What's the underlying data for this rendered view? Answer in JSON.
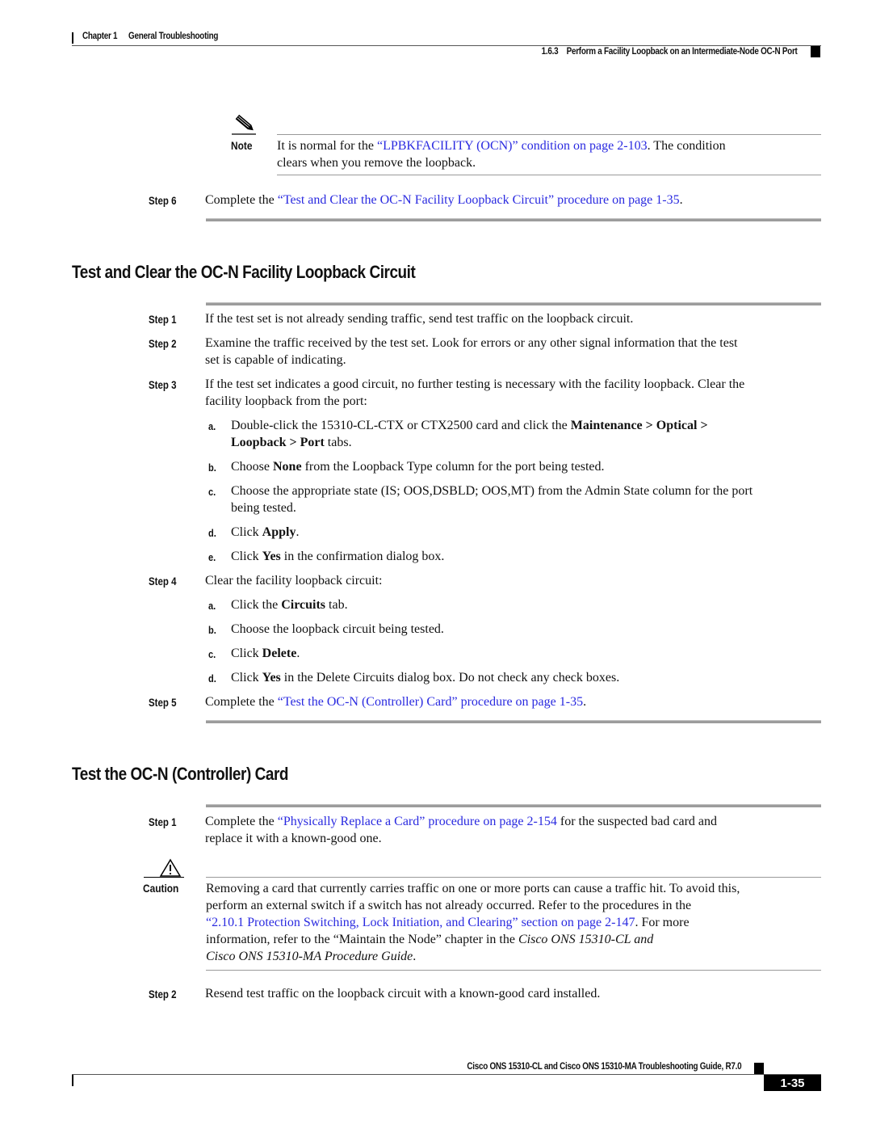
{
  "header": {
    "chapter": "Chapter 1",
    "chapter_title": "General Troubleshooting",
    "section_number": "1.6.3",
    "section_title": "Perform a Facility Loopback on an Intermediate-Node OC-N Port"
  },
  "note": {
    "icon": "pencil-note-icon",
    "label": "Note",
    "text_before": "It is normal for the ",
    "link": "“LPBKFACILITY (OCN)” condition on page 2-103",
    "text_after_line1": ". The condition",
    "line2": "clears when you remove the loopback."
  },
  "step6": {
    "label": "Step 6",
    "text_before": "Complete the ",
    "link": "“Test and Clear the OC-N Facility Loopback Circuit” procedure on page 1-35",
    "text_after": "."
  },
  "section1": {
    "title": "Test and Clear the OC-N Facility Loopback Circuit",
    "steps": [
      {
        "label": "Step 1",
        "text": "If the test set is not already sending traffic, send test traffic on the loopback circuit."
      },
      {
        "label": "Step 2",
        "line1": "Examine the traffic received by the test set. Look for errors or any other signal information that the test",
        "line2": "set is capable of indicating."
      },
      {
        "label": "Step 3",
        "line1": "If the test set indicates a good circuit, no further testing is necessary with the facility loopback. Clear the",
        "line2": "facility loopback from the port:",
        "substeps": [
          {
            "label": "a.",
            "t1": "Double-click the 15310-CL-CTX or CTX2500 card and click the ",
            "b1": "Maintenance > Optical >",
            "b2": "Loopback > Port",
            "t2": " tabs."
          },
          {
            "label": "b.",
            "t1": "Choose ",
            "b1": "None",
            "t2": " from the Loopback Type column for the port being tested."
          },
          {
            "label": "c.",
            "line1": "Choose the appropriate state (IS; OOS,DSBLD; OOS,MT) from the Admin State column for the port",
            "line2": "being tested."
          },
          {
            "label": "d.",
            "t1": "Click ",
            "b1": "Apply",
            "t2": "."
          },
          {
            "label": "e.",
            "t1": "Click ",
            "b1": "Yes",
            "t2": " in the confirmation dialog box."
          }
        ]
      },
      {
        "label": "Step 4",
        "text": "Clear the facility loopback circuit:",
        "substeps": [
          {
            "label": "a.",
            "t1": "Click the ",
            "b1": "Circuits",
            "t2": " tab."
          },
          {
            "label": "b.",
            "text": "Choose the loopback circuit being tested."
          },
          {
            "label": "c.",
            "t1": "Click ",
            "b1": "Delete",
            "t2": "."
          },
          {
            "label": "d.",
            "t1": "Click ",
            "b1": "Yes",
            "t2": " in the Delete Circuits dialog box. Do not check any check boxes."
          }
        ]
      },
      {
        "label": "Step 5",
        "text_before": "Complete the ",
        "link": "“Test the OC-N (Controller) Card” procedure on page 1-35",
        "text_after": "."
      }
    ]
  },
  "section2": {
    "title": "Test the OC-N (Controller) Card",
    "step1": {
      "label": "Step 1",
      "text_before": "Complete the ",
      "link": "“Physically Replace a Card” procedure on page 2-154",
      "text_after": " for the suspected bad card and",
      "line2": "replace it with a known-good one."
    },
    "caution": {
      "icon": "warning-triangle-icon",
      "label": "Caution",
      "line1": "Removing a card that currently carries traffic on one or more ports can cause a traffic hit. To avoid this,",
      "line2": "perform an external switch if a switch has not already occurred. Refer to the procedures in the",
      "link": "“2.10.1  Protection Switching, Lock Initiation, and Clearing” section on page 2-147",
      "line3_after": ". For more",
      "line4_before": "information, refer to the “Maintain the Node” chapter in the ",
      "line4_italic": "Cisco ONS 15310-CL and",
      "line5_italic": "Cisco ONS 15310-MA Procedure Guide",
      "line5_after": "."
    },
    "step2": {
      "label": "Step 2",
      "text": "Resend test traffic on the loopback circuit with a known-good card installed."
    }
  },
  "footer": {
    "title": "Cisco ONS 15310-CL and Cisco ONS 15310-MA Troubleshooting Guide, R7.0",
    "page": "1-35"
  },
  "colors": {
    "link": "#2a2ae0",
    "rule": "#9c9c9c"
  }
}
